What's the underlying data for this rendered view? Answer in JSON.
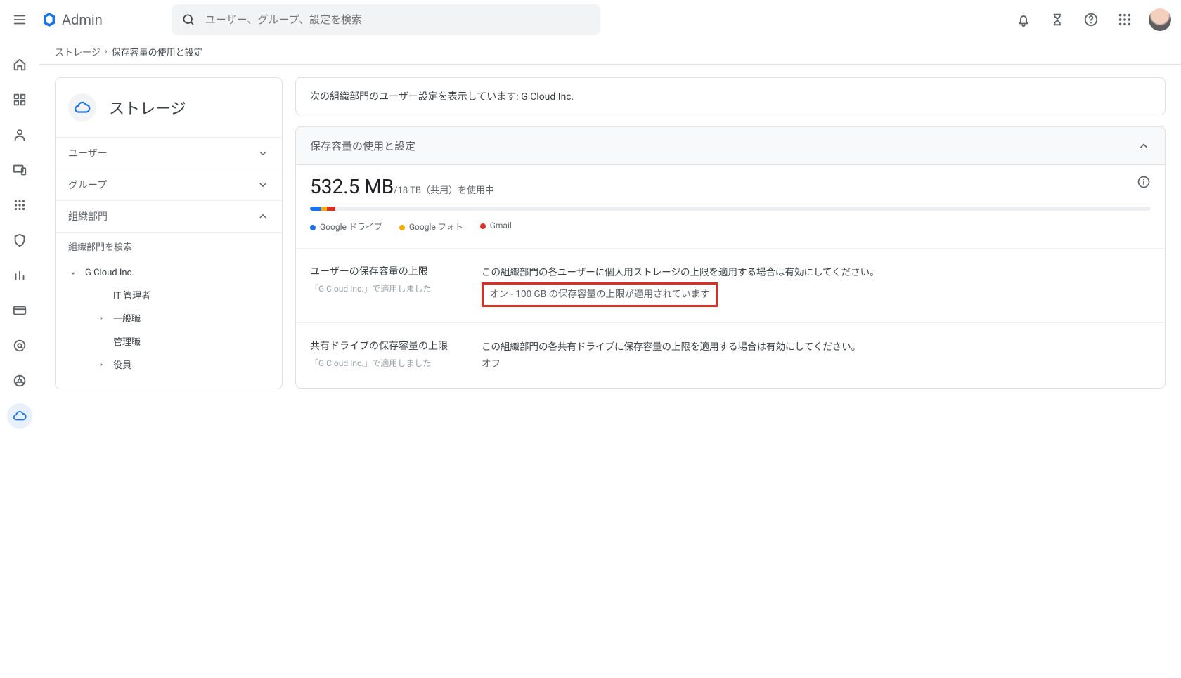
{
  "header": {
    "product": "Admin",
    "search_placeholder": "ユーザー、グループ、設定を検索"
  },
  "breadcrumb": {
    "parent": "ストレージ",
    "sep": "›",
    "current": "保存容量の使用と設定"
  },
  "left_panel": {
    "title": "ストレージ",
    "acc_user": "ユーザー",
    "acc_group": "グループ",
    "acc_org": "組織部門",
    "org_search": "組織部門を検索",
    "tree": {
      "root": "G Cloud Inc.",
      "items": [
        "IT 管理者",
        "一般職",
        "管理職",
        "役員"
      ]
    }
  },
  "main": {
    "info_strip_prefix": "次の組織部門のユーザー設定を表示しています: ",
    "info_strip_org": "G Cloud Inc.",
    "card_title": "保存容量の使用と設定",
    "usage": {
      "big": "532.5 MB",
      "of": "/18 TB（共用）を使用中",
      "legend": {
        "drive": "Google ドライブ",
        "photos": "Google フォト",
        "gmail": "Gmail"
      }
    },
    "rows": [
      {
        "title": "ユーザーの保存容量の上限",
        "applied": "「G Cloud Inc.」で適用しました",
        "desc": "この組織部門の各ユーザーに個人用ストレージの上限を適用する場合は有効にしてください。",
        "status": "オン - 100 GB の保存容量の上限が適用されています",
        "highlight": true
      },
      {
        "title": "共有ドライブの保存容量の上限",
        "applied": "「G Cloud Inc.」で適用しました",
        "desc": "この組織部門の各共有ドライブに保存容量の上限を適用する場合は有効にしてください。",
        "status": "オフ",
        "highlight": false
      }
    ]
  }
}
